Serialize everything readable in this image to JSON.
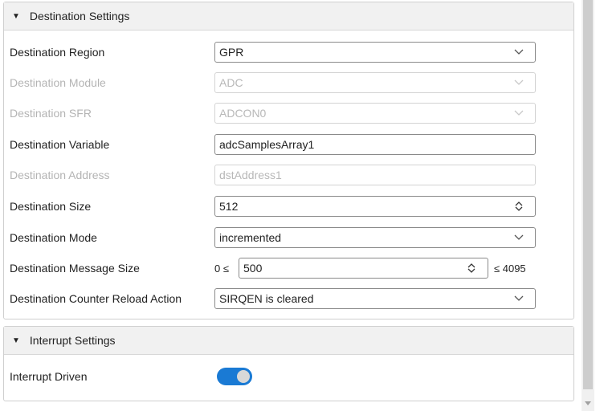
{
  "destination": {
    "title": "Destination Settings",
    "region": {
      "label": "Destination Region",
      "value": "GPR"
    },
    "module": {
      "label": "Destination Module",
      "value": "ADC"
    },
    "sfr": {
      "label": "Destination SFR",
      "value": "ADCON0"
    },
    "variable": {
      "label": "Destination Variable",
      "value": "adcSamplesArray1"
    },
    "address": {
      "label": "Destination Address",
      "value": "dstAddress1"
    },
    "size": {
      "label": "Destination Size",
      "value": "512"
    },
    "mode": {
      "label": "Destination Mode",
      "value": "incremented"
    },
    "message_size": {
      "label": "Destination Message Size",
      "min_text": "0 ≤",
      "value": "500",
      "max_text": "≤ 4095"
    },
    "reload": {
      "label": "Destination Counter Reload Action",
      "value": "SIRQEN is cleared"
    }
  },
  "interrupt": {
    "title": "Interrupt Settings",
    "driven": {
      "label": "Interrupt Driven",
      "enabled": true
    }
  },
  "colors": {
    "accent": "#1a7ad4",
    "disabled_text": "#b4b4b4"
  }
}
